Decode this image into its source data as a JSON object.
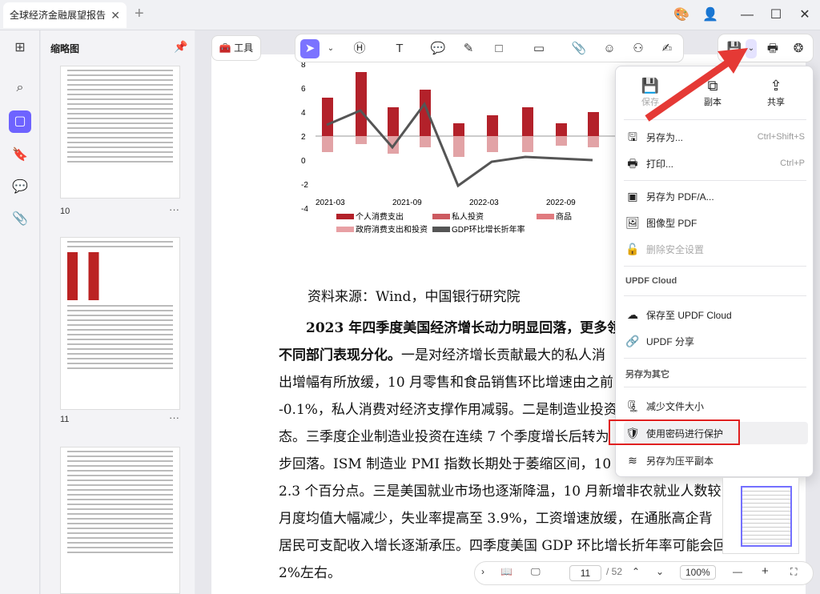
{
  "tab": {
    "title": "全球经济金融展望报告"
  },
  "toolbar": {
    "tool_label": "工具"
  },
  "sidebar": {
    "title": "缩略图",
    "pages": [
      "10",
      "11"
    ]
  },
  "chart_data": {
    "type": "bar",
    "y_ticks": [
      "8",
      "6",
      "4",
      "2",
      "0",
      "-2",
      "-4"
    ],
    "x_ticks": [
      "2021-03",
      "2021-09",
      "2022-03",
      "2022-09"
    ],
    "legend": [
      "个人消费支出",
      "私人投资",
      "商品",
      "政府消费支出和投资",
      "GDP环比增长折年率"
    ]
  },
  "doc": {
    "source": "资料来源：Wind，中国银行研究院",
    "l1": "2023 年四季度美国经济增长动力明显回落，更多领",
    "l2a": "不同部门表现分化。",
    "l2b": "一是对经济增长贡献最大的私人消",
    "l3": "出增幅有所放缓，10 月零售和食品销售环比增速由之前",
    "l4": "-0.1%，私人消费对经济支撑作用减弱。二是制造业投资",
    "l5": "态。三季度企业制造业投资在连续 7 个季度增长后转为",
    "l6": "步回落。ISM 制造业 PMI 指数长期处于萎缩区间，10 月",
    "l7": "2.3 个百分点。三是美国就业市场也逐渐降温，10 月新增非农就业人数较",
    "l8": "月度均值大幅减少，失业率提高至 3.9%，工资增速放缓，在通胀高企背",
    "l9": "居民可支配收入增长逐渐承压。四季度美国 GDP 环比增长折年率可能会回",
    "l10": "2%左右。"
  },
  "menu": {
    "save": "保存",
    "copy": "副本",
    "share": "共享",
    "save_as": "另存为...",
    "save_as_sc": "Ctrl+Shift+S",
    "print": "打印...",
    "print_sc": "Ctrl+P",
    "save_pdfa": "另存为 PDF/A...",
    "image_pdf": "图像型 PDF",
    "remove_security": "删除安全设置",
    "cloud_section": "UPDF Cloud",
    "save_cloud": "保存至 UPDF Cloud",
    "updf_share": "UPDF 分享",
    "save_other": "另存为其它",
    "reduce": "减少文件大小",
    "password": "使用密码进行保护",
    "flatten": "另存为压平副本"
  },
  "bottom": {
    "page": "11",
    "total": "/ 52",
    "zoom": "100%"
  }
}
